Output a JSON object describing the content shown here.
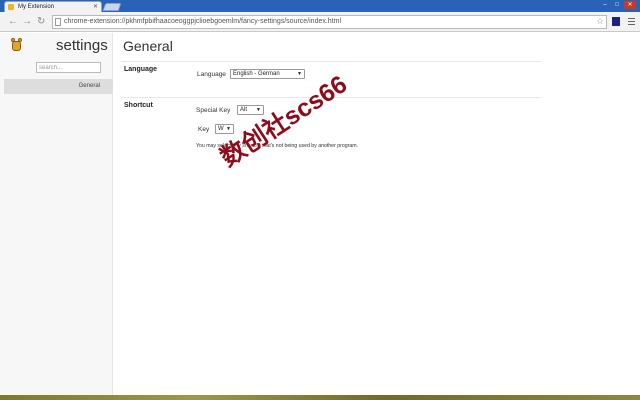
{
  "browser": {
    "tab_title": "My Extension",
    "url": "chrome-extension://pkhmfpbifhaacoeoggpjclioebgoemlm/fancy-settings/source/index.html"
  },
  "sidebar": {
    "title": "settings",
    "search_placeholder": "search...",
    "nav_general": "General"
  },
  "main": {
    "title": "General",
    "language": {
      "section": "Language",
      "label": "Language",
      "value": "English - German"
    },
    "shortcut": {
      "section": "Shortcut",
      "special_key_label": "Special Key",
      "special_key_value": "Alt",
      "key_label": "Key",
      "key_value": "W",
      "help": "You may select any shortcut that's not being used by another program."
    }
  },
  "watermark": "数创社scs66",
  "icons": {
    "back": "back-arrow-icon",
    "forward": "forward-arrow-icon",
    "reload": "reload-icon",
    "bookmark": "star-icon",
    "menu": "hamburger-icon",
    "logo": "extension-logo-icon"
  },
  "colors": {
    "tabstrip": "#2a62b8",
    "sidebar_bg": "#f7f7f7",
    "nav_selected": "#dddddd",
    "watermark": "#8b0d1c"
  }
}
